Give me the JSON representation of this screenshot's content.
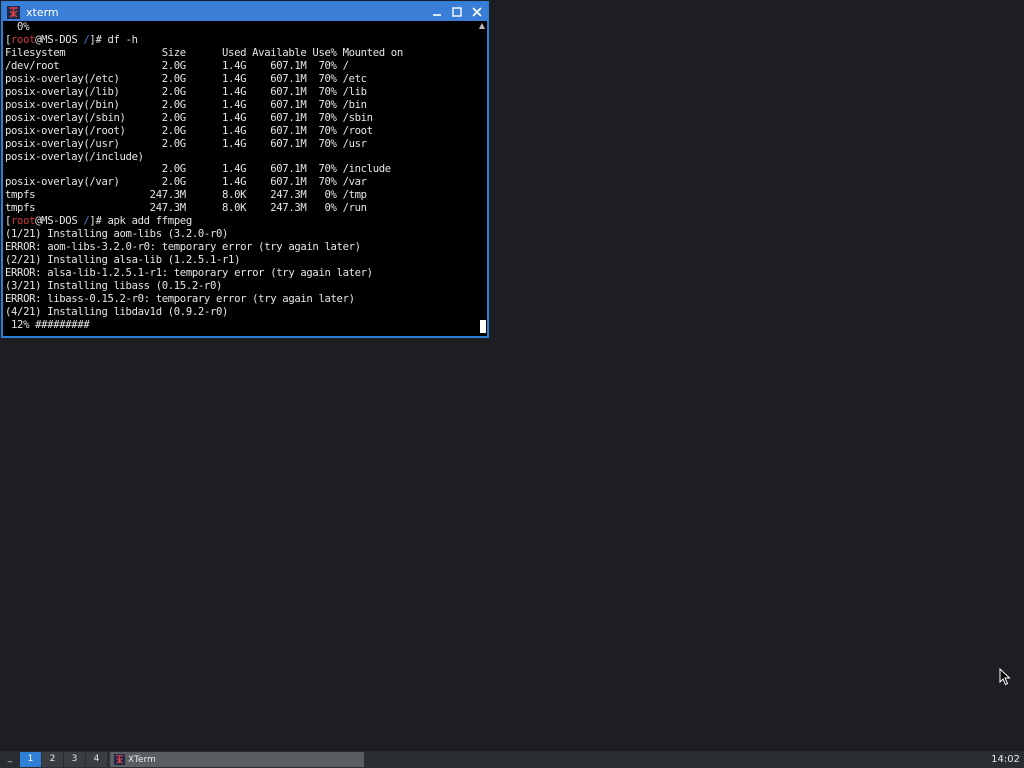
{
  "window": {
    "title": "xterm",
    "minimize_label": "_",
    "maximize_label": "□",
    "close_label": "✕"
  },
  "terminal": {
    "lines": [
      {
        "text": "  0%"
      },
      {
        "user": "root",
        "host": "@MS-DOS ",
        "dir": "/",
        "cmd": "]# df -h",
        "bracket": "["
      },
      {
        "text": "Filesystem                Size      Used Available Use% Mounted on"
      },
      {
        "text": "/dev/root                 2.0G      1.4G    607.1M  70% /"
      },
      {
        "text": "posix-overlay(/etc)       2.0G      1.4G    607.1M  70% /etc"
      },
      {
        "text": "posix-overlay(/lib)       2.0G      1.4G    607.1M  70% /lib"
      },
      {
        "text": "posix-overlay(/bin)       2.0G      1.4G    607.1M  70% /bin"
      },
      {
        "text": "posix-overlay(/sbin)      2.0G      1.4G    607.1M  70% /sbin"
      },
      {
        "text": "posix-overlay(/root)      2.0G      1.4G    607.1M  70% /root"
      },
      {
        "text": "posix-overlay(/usr)       2.0G      1.4G    607.1M  70% /usr"
      },
      {
        "text": "posix-overlay(/include)"
      },
      {
        "text": "                          2.0G      1.4G    607.1M  70% /include"
      },
      {
        "text": "posix-overlay(/var)       2.0G      1.4G    607.1M  70% /var"
      },
      {
        "text": "tmpfs                   247.3M      8.0K    247.3M   0% /tmp"
      },
      {
        "text": "tmpfs                   247.3M      8.0K    247.3M   0% /run"
      },
      {
        "user": "root",
        "host": "@MS-DOS ",
        "dir": "/",
        "cmd": "]# apk add ffmpeg",
        "bracket": "["
      },
      {
        "text": "(1/21) Installing aom-libs (3.2.0-r0)"
      },
      {
        "text": "ERROR: aom-libs-3.2.0-r0: temporary error (try again later)"
      },
      {
        "text": "(2/21) Installing alsa-lib (1.2.5.1-r1)"
      },
      {
        "text": "ERROR: alsa-lib-1.2.5.1-r1: temporary error (try again later)"
      },
      {
        "text": "(3/21) Installing libass (0.15.2-r0)"
      },
      {
        "text": "ERROR: libass-0.15.2-r0: temporary error (try again later)"
      },
      {
        "text": "(4/21) Installing libdav1d (0.9.2-r0)"
      },
      {
        "text": " 12% #########"
      }
    ]
  },
  "taskbar": {
    "menu_label": "_",
    "workspaces": [
      {
        "label": "1",
        "active": true
      },
      {
        "label": "2",
        "active": false
      },
      {
        "label": "3",
        "active": false
      },
      {
        "label": "4",
        "active": false
      }
    ],
    "task_label": "XTerm",
    "clock": "14:02"
  },
  "colors": {
    "accent": "#2f7fd6",
    "prompt_user": "#d23b3b",
    "prompt_dir": "#4a78d6",
    "desktop": "#1c1e21"
  },
  "icons": {
    "app": "xterm-icon",
    "minimize": "minimize-icon",
    "maximize": "maximize-icon",
    "close": "close-icon",
    "cursor": "mouse-pointer-icon"
  }
}
